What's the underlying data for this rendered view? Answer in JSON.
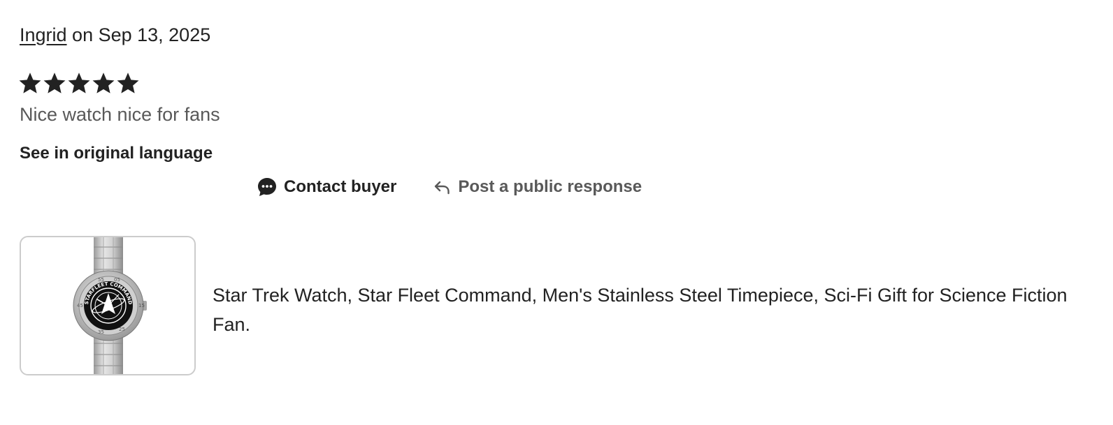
{
  "review": {
    "reviewer_name": "Ingrid",
    "date_text": " on Sep 13, 2025",
    "rating": 5,
    "rating_max": 5,
    "text": "Nice watch nice for fans",
    "translate_label": "See in original language"
  },
  "actions": {
    "contact_label": "Contact buyer",
    "contact_icon": "chat-bubble-icon",
    "respond_label": "Post a public response",
    "respond_icon": "reply-arrow-icon"
  },
  "listing": {
    "title": "Star Trek Watch, Star Fleet Command, Men's Stainless Steel Timepiece, Sci-Fi Gift for Science Fiction Fan.",
    "image_label": "STARFLEET COMMAND"
  },
  "colors": {
    "text_primary": "#222222",
    "text_secondary": "#595959",
    "border": "#cccccc"
  }
}
